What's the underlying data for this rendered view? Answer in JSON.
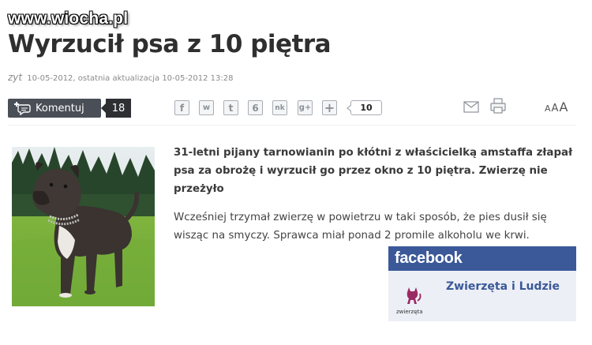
{
  "watermark": "www.wiocha.pl",
  "article": {
    "title": "Wyrzucił psa z 10 piętra",
    "author": "zyt",
    "meta": "10-05-2012, ostatnia aktualizacja 10-05-2012 13:28",
    "lead": "31-letni pijany tarnowianin po kłótni z właścicielką amstaffa złapał psa za obrożę i wyrzucił go przez okno z 10 piętra. Zwierzę nie przeżyło",
    "body": "Wcześniej trzymał zwierzę w powietrzu w taki sposób, że pies dusił się wisząc na smyczy. Sprawca miał ponad 2 promile alkoholu we krwi."
  },
  "toolbar": {
    "comment_label": "Komentuj",
    "comment_count": "18",
    "share_count": "10",
    "share_icons": [
      {
        "name": "facebook-icon",
        "glyph": "f"
      },
      {
        "name": "wykop-icon",
        "glyph": "w"
      },
      {
        "name": "twitter-icon",
        "glyph": "t"
      },
      {
        "name": "blip-icon",
        "glyph": "6"
      },
      {
        "name": "nk-icon",
        "glyph": "nk"
      },
      {
        "name": "google-plus-icon",
        "glyph": "g+"
      },
      {
        "name": "more-icon",
        "glyph": "+"
      }
    ],
    "font_sizes": [
      "A",
      "A",
      "A"
    ]
  },
  "facebook": {
    "brand": "facebook",
    "page_name": "Zwierzęta i Ludzie",
    "page_caption": "zwierzęta",
    "brand_color": "#3b5998"
  }
}
